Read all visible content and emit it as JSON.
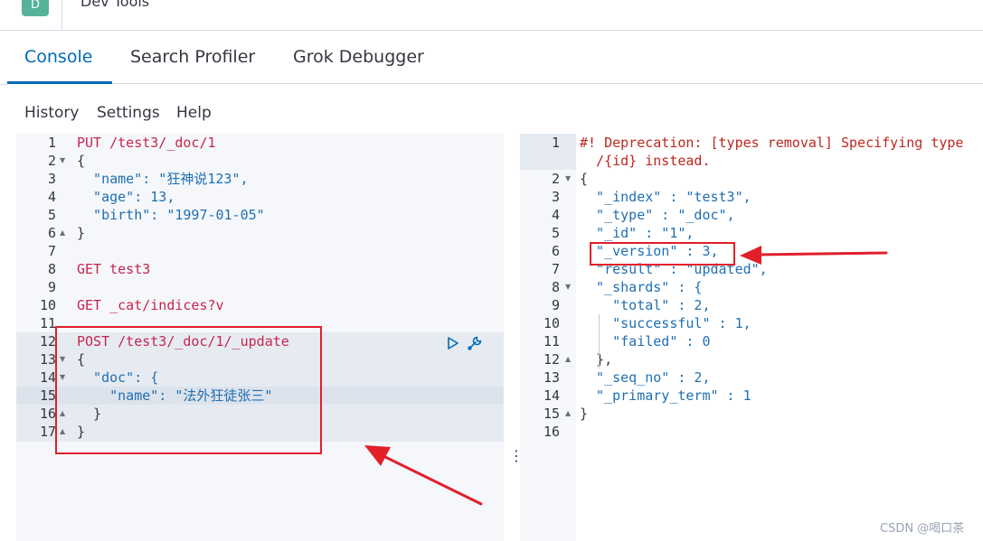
{
  "header": {
    "avatar_letter": "D",
    "title": "Dev Tools"
  },
  "tabs": [
    {
      "label": "Console",
      "active": true
    },
    {
      "label": "Search Profiler",
      "active": false
    },
    {
      "label": "Grok Debugger",
      "active": false
    }
  ],
  "toolbar": {
    "history": "History",
    "settings": "Settings",
    "help": "Help"
  },
  "request": {
    "line_numbers": [
      "1",
      "2",
      "3",
      "4",
      "5",
      "6",
      "7",
      "8",
      "9",
      "10",
      "11",
      "12",
      "13",
      "14",
      "15",
      "16",
      "17"
    ],
    "lines": [
      "PUT /test3/_doc/1",
      "{",
      "  \"name\": \"狂神说123\",",
      "  \"age\": 13,",
      "  \"birth\": \"1997-01-05\"",
      "}",
      "",
      "GET test3",
      "",
      "GET _cat/indices?v",
      "",
      "POST /test3/_doc/1/_update",
      "{",
      "  \"doc\": {",
      "    \"name\": \"法外狂徒张三\"",
      "  }",
      "}"
    ]
  },
  "response": {
    "line_numbers": [
      "1",
      "2",
      "3",
      "4",
      "5",
      "6",
      "7",
      "8",
      "9",
      "10",
      "11",
      "12",
      "13",
      "14",
      "15",
      "16"
    ],
    "lines": [
      "#! Deprecation: [types removal] Specifying type",
      "  /{id} instead.",
      "{",
      "  \"_index\" : \"test3\",",
      "  \"_type\" : \"_doc\",",
      "  \"_id\" : \"1\",",
      "  \"_version\" : 3,",
      "  \"result\" : \"updated\",",
      "  \"_shards\" : {",
      "    \"total\" : 2,",
      "    \"successful\" : 1,",
      "    \"failed\" : 0",
      "  },",
      "  \"_seq_no\" : 2,",
      "  \"_primary_term\" : 1",
      "}",
      ""
    ]
  },
  "splitter_glyph": "⋮",
  "watermark": "CSDN @喝口茶",
  "icons": {
    "play": "play-icon",
    "wrench": "wrench-icon"
  },
  "colors": {
    "accent": "#006bb4",
    "annotation": "#e1202a"
  }
}
